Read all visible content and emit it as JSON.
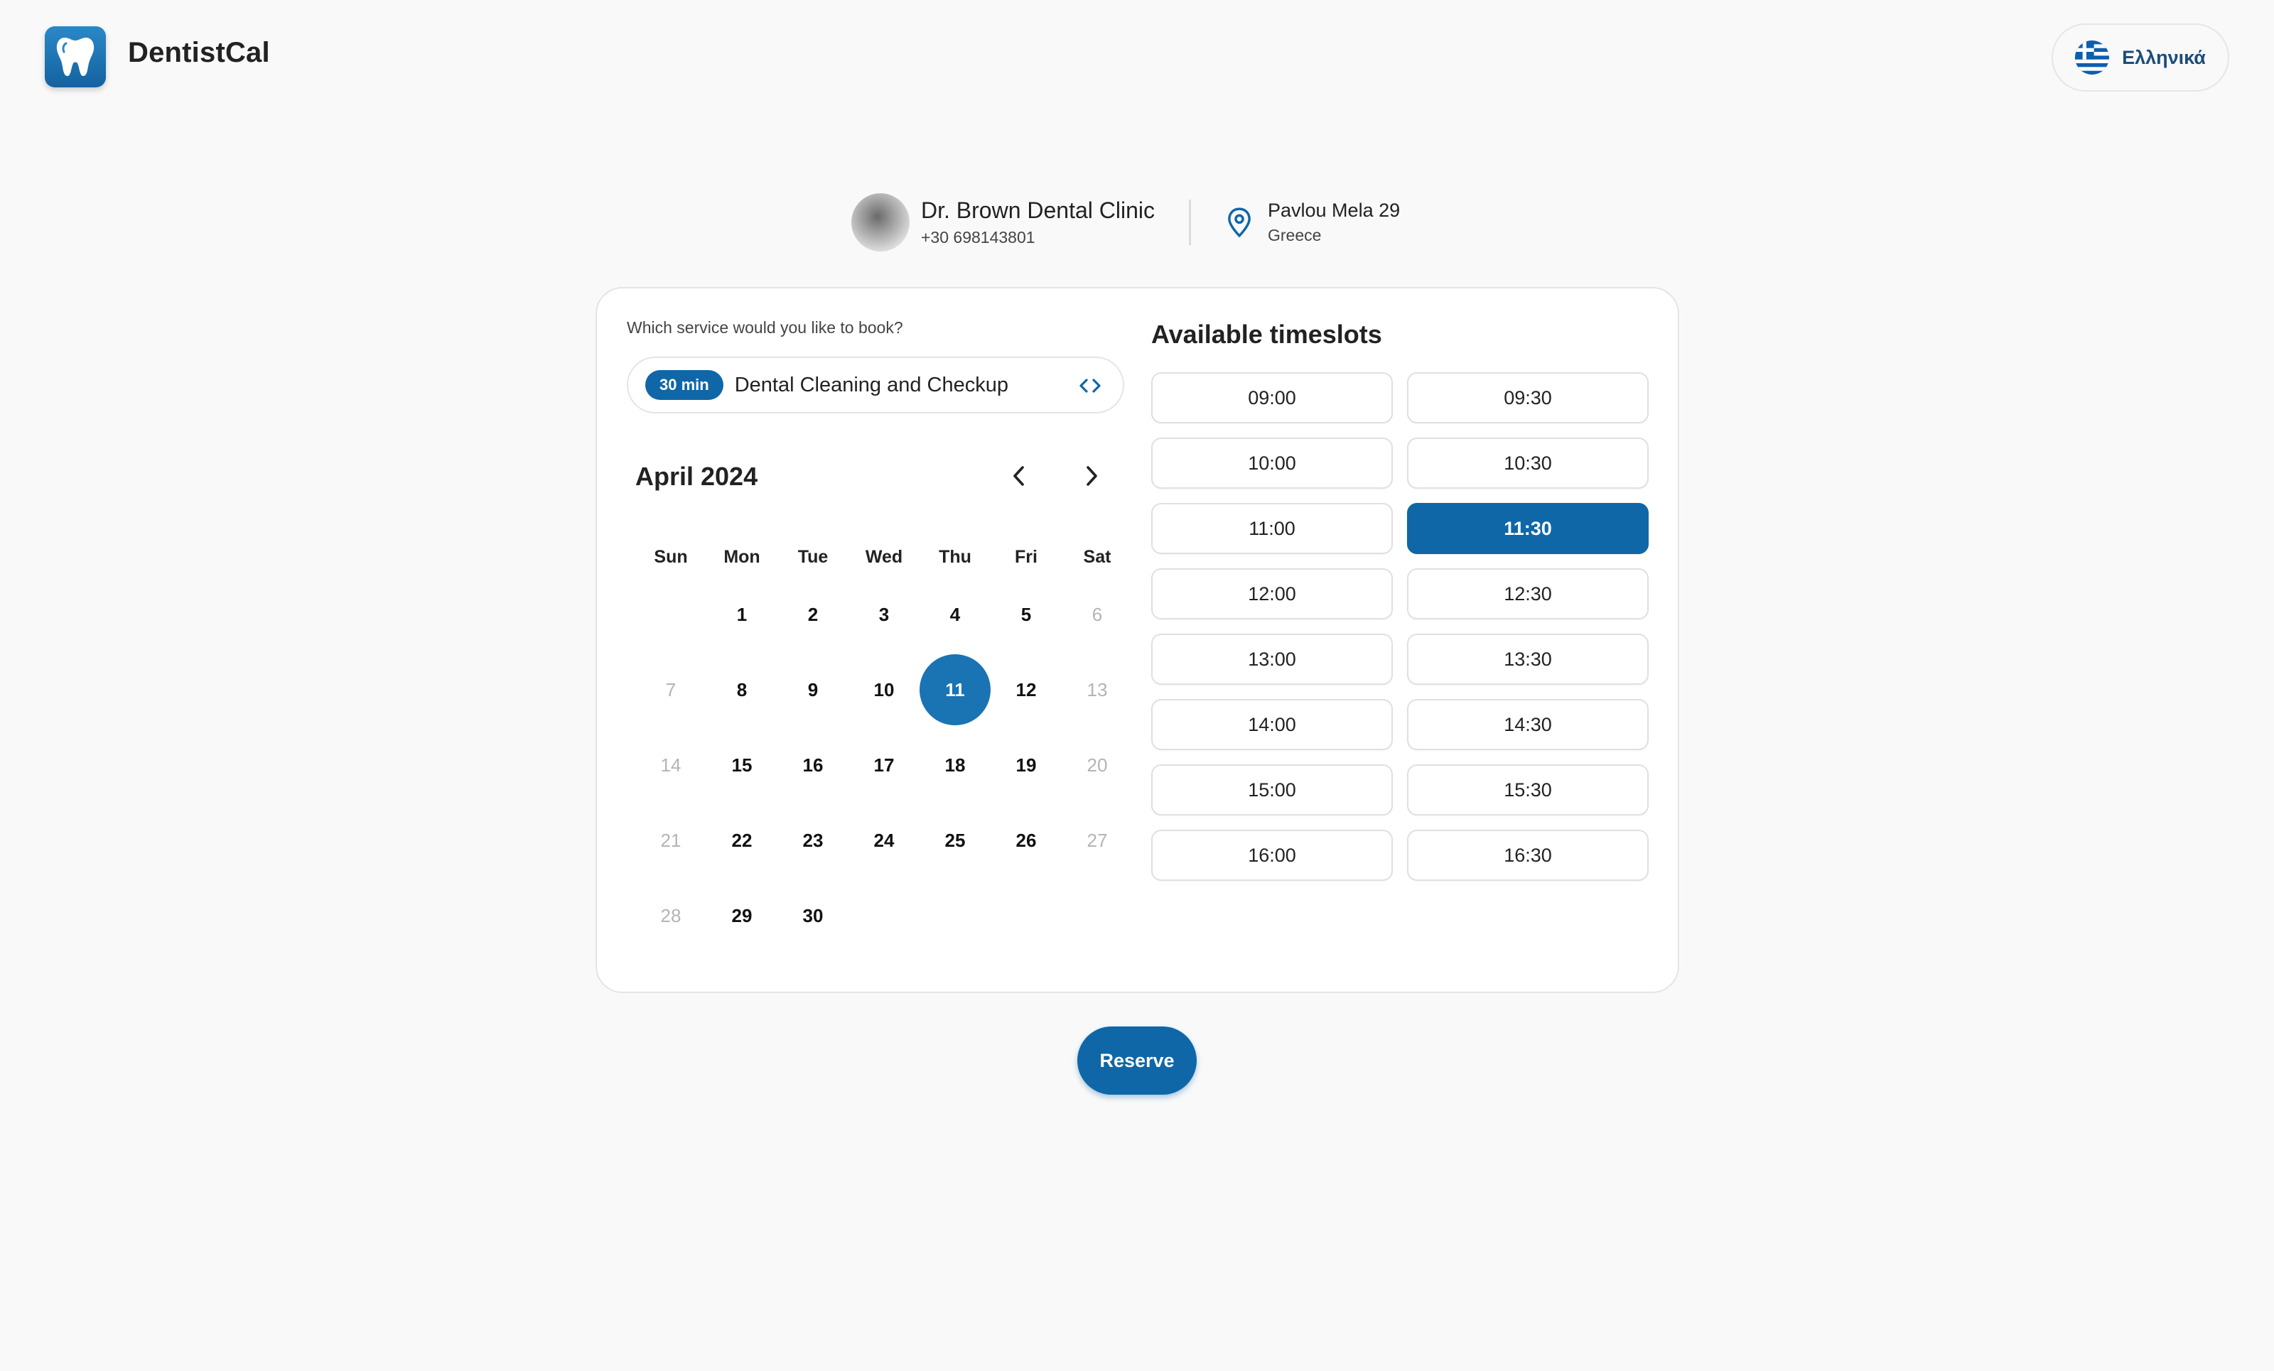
{
  "header": {
    "brand": "DentistCal",
    "logo_icon": "tooth-icon",
    "language_label": "Ελληνικά",
    "language_flag_icon": "greek-flag-icon"
  },
  "clinic": {
    "name": "Dr. Brown Dental Clinic",
    "phone": "+30 698143801",
    "address_street": "Pavlou Mela 29",
    "address_country": "Greece",
    "location_icon": "map-pin-icon"
  },
  "service": {
    "question": "Which service would you like to book?",
    "duration": "30 min",
    "name": "Dental Cleaning and Checkup",
    "expand_icon": "chevron-expand-icon"
  },
  "calendar": {
    "month_title": "April 2024",
    "weekdays": [
      "Sun",
      "Mon",
      "Tue",
      "Wed",
      "Thu",
      "Fri",
      "Sat"
    ],
    "first_weekday_index": 1,
    "days_in_month": 30,
    "selected_day": 11,
    "disabled_days": [
      6,
      7,
      13,
      14,
      20,
      21,
      27,
      28
    ]
  },
  "timeslots": {
    "title": "Available timeslots",
    "slots": [
      "09:00",
      "09:30",
      "10:00",
      "10:30",
      "11:00",
      "11:30",
      "12:00",
      "12:30",
      "13:00",
      "13:30",
      "14:00",
      "14:30",
      "15:00",
      "15:30",
      "16:00",
      "16:30"
    ],
    "selected": "11:30"
  },
  "actions": {
    "reserve_label": "Reserve"
  },
  "colors": {
    "primary": "#0f67a8",
    "selected_day": "#1a73b3",
    "disabled_text": "#b4b4b4",
    "background": "#f9f9f9"
  }
}
